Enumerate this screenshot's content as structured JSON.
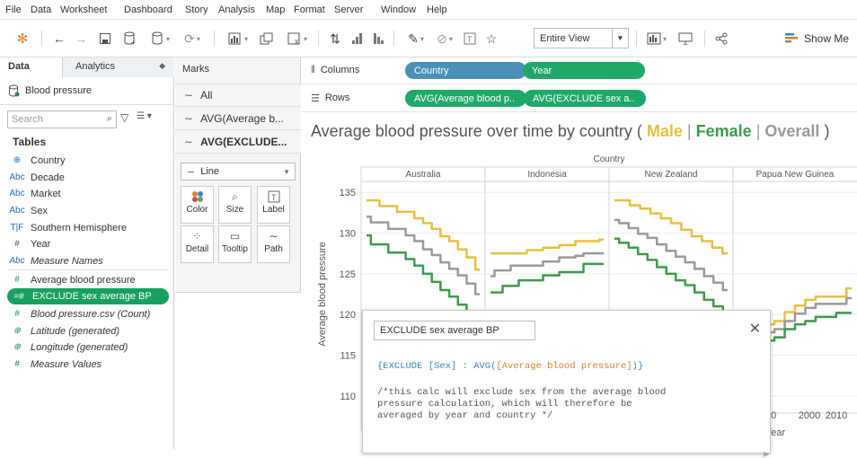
{
  "menu": [
    "File",
    "Data",
    "Worksheet",
    "Dashboard",
    "Story",
    "Analysis",
    "Map",
    "Format",
    "Server",
    "Window",
    "Help"
  ],
  "toolbar": {
    "fit_value": "Entire View",
    "show_me_label": "Show Me"
  },
  "data_pane": {
    "tab_data": "Data",
    "tab_analytics": "Analytics",
    "source": "Blood pressure",
    "search_placeholder": "Search",
    "tables_heading": "Tables",
    "fields": [
      {
        "label": "Country",
        "icon": "globe-icon",
        "kind": "dimension"
      },
      {
        "label": "Decade",
        "icon": "abc-icon",
        "kind": "dimension"
      },
      {
        "label": "Market",
        "icon": "abc-icon",
        "kind": "dimension"
      },
      {
        "label": "Sex",
        "icon": "abc-icon",
        "kind": "dimension"
      },
      {
        "label": "Southern Hemisphere",
        "icon": "tf-icon",
        "kind": "dimension"
      },
      {
        "label": "Year",
        "icon": "hash-icon",
        "kind": "dimension"
      },
      {
        "label": "Measure Names",
        "icon": "abc-icon",
        "kind": "dimension"
      },
      {
        "label": "Average blood pressure",
        "icon": "hash-icon",
        "kind": "measure"
      },
      {
        "label": "EXCLUDE sex average BP",
        "icon": "hash-icon",
        "kind": "measure"
      },
      {
        "label": "Blood pressure.csv (Count)",
        "icon": "hash-icon",
        "kind": "measure"
      },
      {
        "label": "Latitude (generated)",
        "icon": "globe-icon",
        "kind": "measure"
      },
      {
        "label": "Longitude (generated)",
        "icon": "globe-icon",
        "kind": "measure"
      },
      {
        "label": "Measure Values",
        "icon": "hash-icon",
        "kind": "measure"
      }
    ]
  },
  "marks": {
    "heading": "Marks",
    "cards": [
      "All",
      "AVG(Average b...",
      "AVG(EXCLUDE..."
    ],
    "mark_type": "Line",
    "buttons": [
      "Color",
      "Size",
      "Label",
      "Detail",
      "Tooltip",
      "Path"
    ]
  },
  "shelves": {
    "columns_label": "Columns",
    "rows_label": "Rows",
    "columns_pills": [
      "Country",
      "Year"
    ],
    "rows_pills": [
      "AVG(Average blood p..",
      "AVG(EXCLUDE sex a.."
    ]
  },
  "viz": {
    "title_main": "Average blood pressure over time by country (",
    "title_male": "Male",
    "title_sep1": "|",
    "title_female": "Female",
    "title_sep2": "|",
    "title_overall": "Overall",
    "title_close": ")",
    "colors": {
      "male": "#e8c040",
      "female": "#3e9a4c",
      "overall": "#9a9a9a",
      "pill_dim": "#4a90b8",
      "pill_measure": "#20a86a"
    },
    "x_header": "Country",
    "x_axis_label": "Year"
  },
  "chart_data": {
    "type": "line",
    "title": "Average blood pressure over time by country (Male | Female | Overall)",
    "xlabel": "Year",
    "ylabel": "Average blood pressure",
    "ylim": [
      109,
      136
    ],
    "yticks": [
      110,
      115,
      120,
      125,
      130,
      135
    ],
    "xticks_visible": [
      "1990",
      "2000",
      "2010"
    ],
    "panels": [
      {
        "country": "Australia",
        "series": [
          {
            "name": "Male",
            "values": [
              134,
              134,
              133.3,
              133.3,
              132.6,
              132.6,
              131.8,
              131.2,
              130.5,
              129.6,
              129.0,
              128.0,
              127.0,
              125.5
            ]
          },
          {
            "name": "Overall",
            "values": [
              132,
              131.3,
              131.3,
              130.5,
              130.5,
              129.7,
              129,
              128,
              127.3,
              126.4,
              125.6,
              124.8,
              123.8,
              122.5
            ]
          },
          {
            "name": "Female",
            "values": [
              129.7,
              128.6,
              128.6,
              127.6,
              127.6,
              126.8,
              126,
              125,
              124,
              123,
              122.2,
              121.2,
              120.2,
              119.2
            ]
          }
        ]
      },
      {
        "country": "Indonesia",
        "series": [
          {
            "name": "Male",
            "values": [
              127.5,
              127.5,
              127.5,
              127.5,
              127.5,
              127.9,
              127.9,
              128.2,
              128.2,
              128.5,
              128.5,
              129,
              129,
              129,
              129.2
            ]
          },
          {
            "name": "Overall",
            "values": [
              124.7,
              125.4,
              125.4,
              126,
              126,
              126,
              126,
              126.5,
              126.5,
              127,
              127,
              127.2,
              127.5,
              127.5,
              127.5
            ]
          },
          {
            "name": "Female",
            "values": [
              122.7,
              122.7,
              123.5,
              123.5,
              124.2,
              124.2,
              124.2,
              124.8,
              124.8,
              125.2,
              125.2,
              125.2,
              126.2,
              126.2,
              126.2
            ]
          }
        ]
      },
      {
        "country": "New Zealand",
        "series": [
          {
            "name": "Male",
            "values": [
              134,
              134,
              133.4,
              133,
              132.4,
              131.8,
              131.2,
              130.4,
              129.6,
              129,
              128.2,
              127.5
            ]
          },
          {
            "name": "Overall",
            "values": [
              131.6,
              131.2,
              130.6,
              129.9,
              129.4,
              128.6,
              127.8,
              127.1,
              126.4,
              125.6,
              124.7,
              123.9,
              123
            ]
          },
          {
            "name": "Female",
            "values": [
              129.3,
              128.8,
              128.2,
              127.4,
              126.7,
              125.8,
              125,
              124.2,
              123.6,
              122.7,
              121.8,
              121,
              120.3
            ]
          }
        ]
      },
      {
        "country": "Papua New Guinea",
        "series": [
          {
            "name": "Male",
            "values": [
              117.5,
              117.5,
              118.2,
              118.8,
              119.2,
              120.3,
              121.1,
              121.8,
              122.2,
              122.2,
              122.2,
              123.2
            ]
          },
          {
            "name": "Overall",
            "values": [
              116.5,
              116.5,
              117.2,
              117.8,
              118.2,
              119.2,
              120.1,
              120.8,
              121.3,
              121.3,
              121.3,
              122
            ]
          },
          {
            "name": "Female",
            "values": [
              115.5,
              115.5,
              116.2,
              116.8,
              117.2,
              118.2,
              118.8,
              119.2,
              119.7,
              119.7,
              120.2,
              120.2
            ]
          }
        ]
      }
    ]
  },
  "calc_dialog": {
    "name": "EXCLUDE sex average BP",
    "formula_open": "{EXCLUDE",
    "formula_dim": "[Sex]",
    "formula_colon": ":",
    "formula_func": "AVG(",
    "formula_field": "[Average blood pressure]",
    "formula_close": ")}",
    "comment_1": "/*this calc will exclude sex from the average blood",
    "comment_2": "pressure calculation, which will therefore be",
    "comment_3": "averaged by year and country */"
  }
}
